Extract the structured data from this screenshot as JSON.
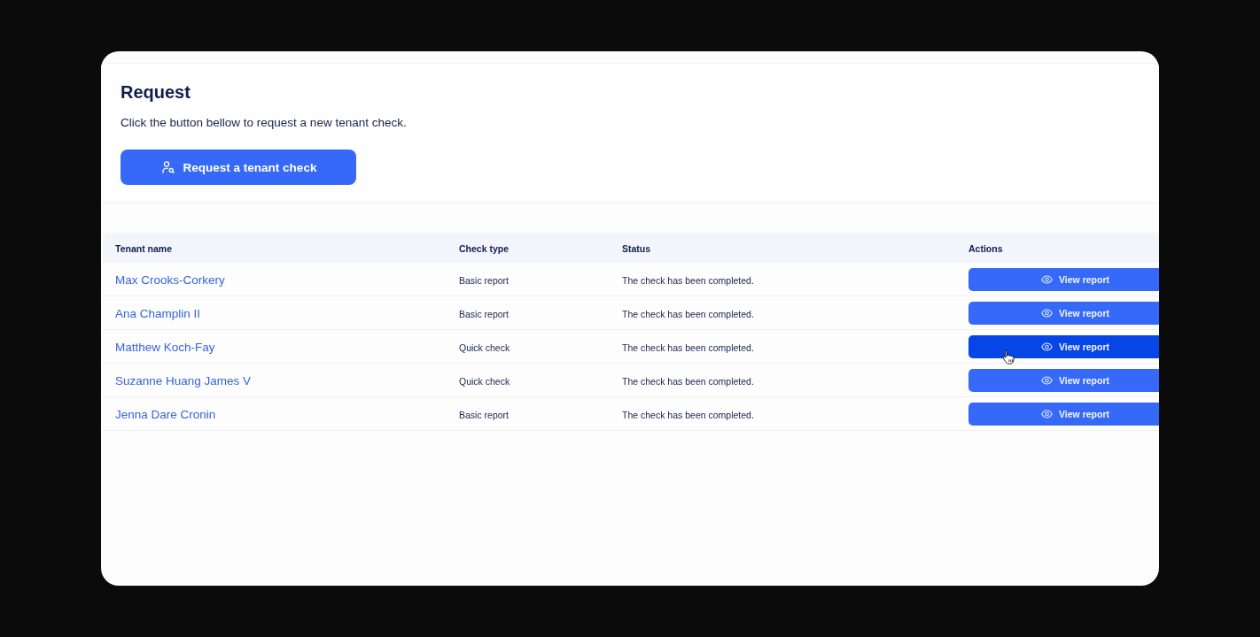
{
  "request": {
    "title": "Request",
    "description": "Click the button bellow to request a new tenant check.",
    "button": "Request a tenant check"
  },
  "table": {
    "columns": [
      "Tenant name",
      "Check type",
      "Status",
      "Actions"
    ],
    "rows": [
      {
        "tenant_name": "Max Crooks-Corkery",
        "check_type": "Basic report",
        "status": "The check has been completed.",
        "action": "View report",
        "hovered": false
      },
      {
        "tenant_name": "Ana Champlin II",
        "check_type": "Basic report",
        "status": "The check has been completed.",
        "action": "View report",
        "hovered": false
      },
      {
        "tenant_name": "Matthew Koch-Fay",
        "check_type": "Quick check",
        "status": "The check has been completed.",
        "action": "View report",
        "hovered": true
      },
      {
        "tenant_name": "Suzanne Huang James V",
        "check_type": "Quick check",
        "status": "The check has been completed.",
        "action": "View report",
        "hovered": false
      },
      {
        "tenant_name": "Jenna Dare Cronin",
        "check_type": "Basic report",
        "status": "The check has been completed.",
        "action": "View report",
        "hovered": false
      }
    ]
  }
}
